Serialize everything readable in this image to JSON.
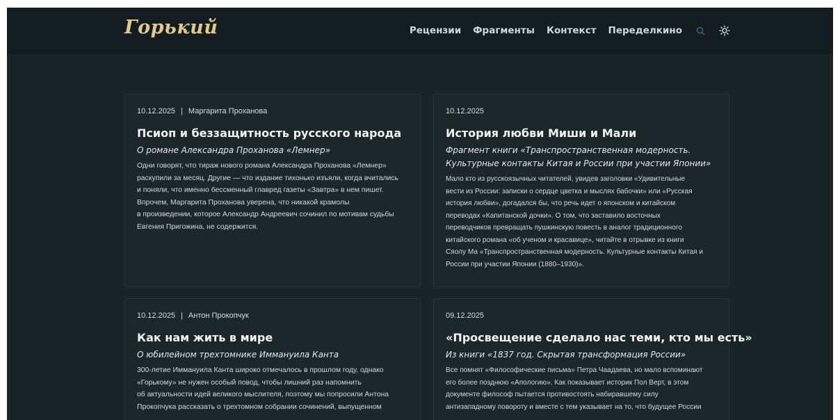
{
  "site": {
    "logo": "Горький",
    "nav": [
      "Рецензии",
      "Фрагменты",
      "Контекст",
      "Переделкино"
    ],
    "icons": [
      "search-icon",
      "sun-icon"
    ]
  },
  "cards": [
    {
      "date": "10.12.2025",
      "author": "Маргарита Проханова",
      "title": "Псиоп и беззащитность русского народа",
      "subtitle": [
        "О романе Александра Проханова «Лемнер»"
      ],
      "body": [
        "Одни говорят, что тираж нового романа Александра Проханова «Лемнер»",
        "раскупили за месяц. Другие — что издание тихонько изъяли, когда вчитались",
        "и поняли, что именно бессменный главред газеты «Завтра» в нем пишет.",
        "Впрочем, Маргарита Проханова уверена, что никакой крамолы",
        "в произведении, которое Александр Андреевич сочинил по мотивам судьбы",
        "Евгения Пригожина, не содержится."
      ]
    },
    {
      "date": "10.12.2025",
      "author": "",
      "title": "История любви Миши и Мали",
      "subtitle": [
        "Фрагмент книги «Транспространственная модерность.",
        "Культурные контакты Китая и России при участии Японии»"
      ],
      "body": [
        "Мало кто из русскоязычных читателей, увидев заголовки «Удивительные",
        "вести из России: записки о сердце цветка и мыслях бабочки» или «Русская",
        "история любви», догадался бы, что речь идет о японском и китайском",
        "переводах «Капитанской дочки». О том, что заставило восточных",
        "переводчиков превращать пушкинскую повесть в аналог традиционного",
        "китайского романа «об ученом и красавице», читайте в отрывке из книги",
        "Сяолу Ма «Транспространственная модерность. Культурные контакты Китая и",
        "России при участии Японии (1880–1930)»."
      ]
    },
    {
      "date": "10.12.2025",
      "author": "Антон Прокопчук",
      "title": "Как нам жить в мире",
      "subtitle": [
        "О юбилейном трехтомнике Иммануила Канта"
      ],
      "body": [
        "300-летие Иммануила Канта широко отмечалось в прошлом году, однако",
        "«Горькому» не нужен особый повод, чтобы лишний раз напомнить",
        "об актуальности идей великого мыслителя, поэтому мы попросили Антона",
        "Прокопчука рассказать о трехтомном собрании сочинений, выпущенном"
      ]
    },
    {
      "date": "09.12.2025",
      "author": "",
      "title": "«Просвещение сделало нас теми, кто мы есть»",
      "subtitle": [
        "Из книги «1837 год. Скрытая трансформация России»"
      ],
      "body": [
        "Все помнят «Философические письма» Петра Чаадаева, но мало вспоминают",
        "его более позднюю «Апологию». Как показывает историк Пол Верт, в этом",
        "документе философ пытается противостоять набиравшему силу",
        "антизападному повороту и вместе с тем указывает на то, что будущее России"
      ]
    }
  ]
}
